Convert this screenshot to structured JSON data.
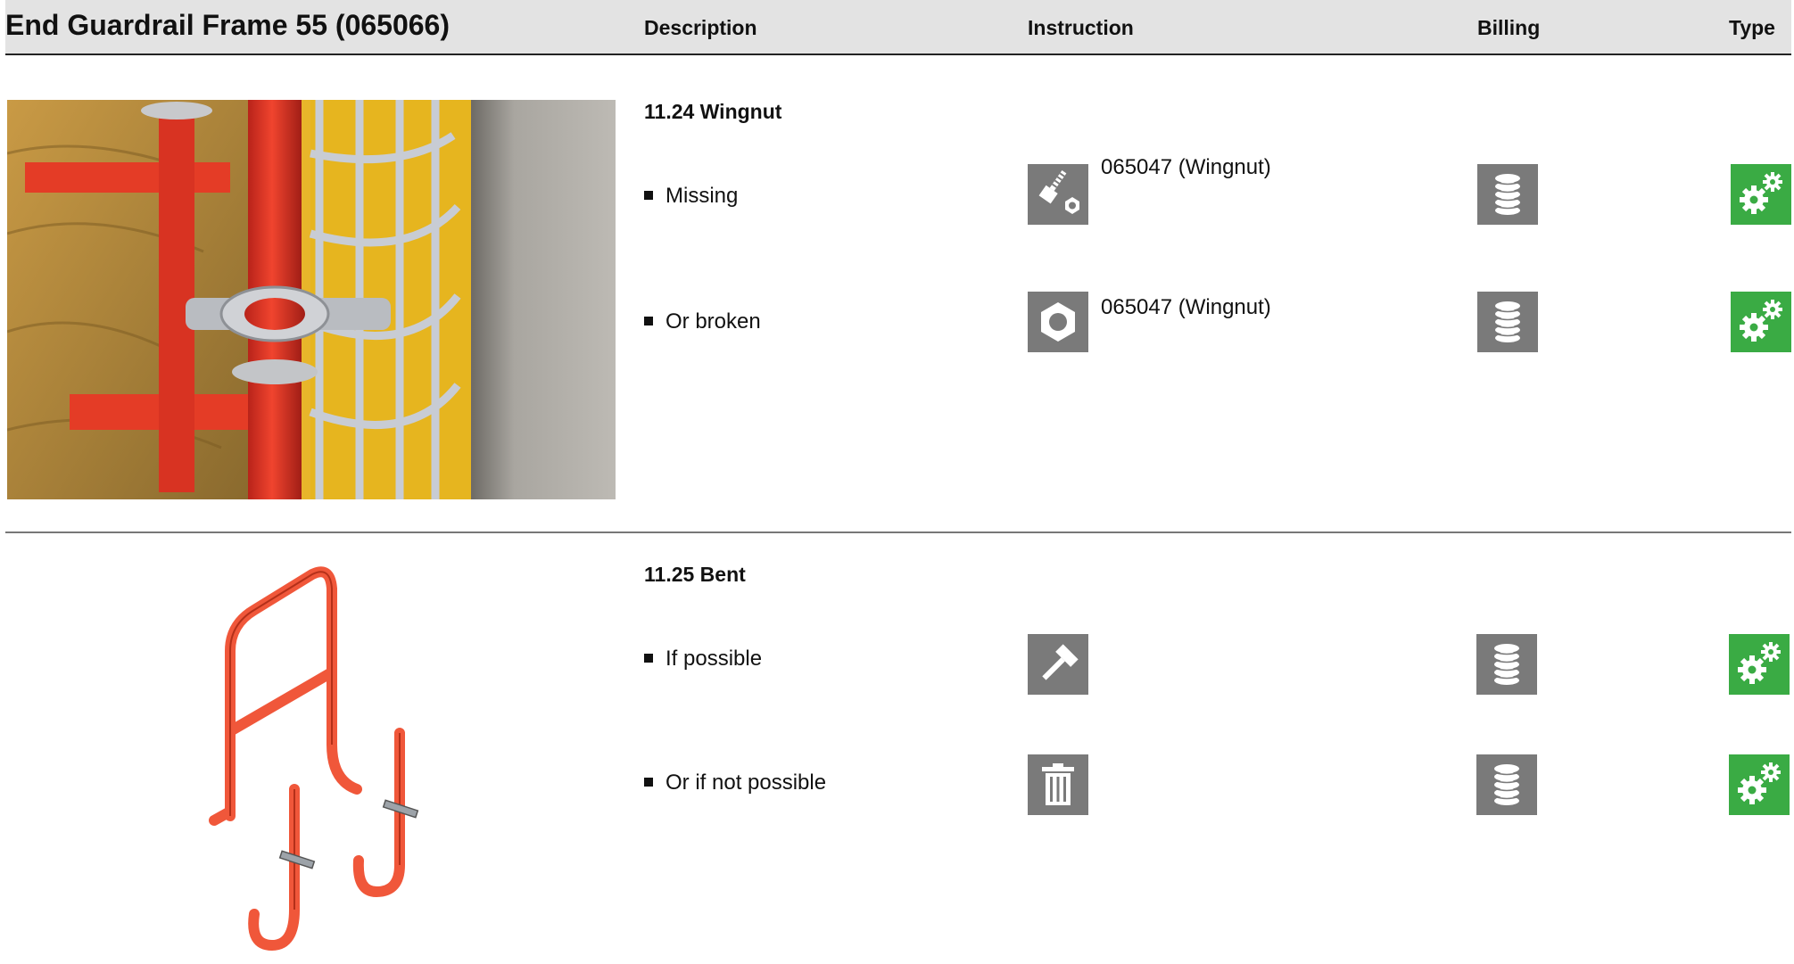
{
  "header": {
    "title": "End Guardrail Frame 55 (065066)",
    "col_description": "Description",
    "col_instruction": "Instruction",
    "col_billing": "Billing",
    "col_type": "Type"
  },
  "sections": [
    {
      "title": "11.24 Wingnut",
      "image": "photo-guardrail-wingnut",
      "items": [
        {
          "label": "Missing",
          "instruction_icon": "bolt-nut-icon",
          "instruction_text": "065047 (Wingnut)",
          "billing_icon": "coin-stack-icon",
          "type_icon": "gears-icon"
        },
        {
          "label": "Or broken",
          "instruction_icon": "nut-icon",
          "instruction_text": "065047 (Wingnut)",
          "billing_icon": "coin-stack-icon",
          "type_icon": "gears-icon"
        }
      ]
    },
    {
      "title": "11.25 Bent",
      "image": "drawing-guardrail-frame",
      "items": [
        {
          "label": "If possible",
          "instruction_icon": "hammer-icon",
          "instruction_text": "",
          "billing_icon": "coin-stack-icon",
          "type_icon": "gears-icon"
        },
        {
          "label": "Or if not possible",
          "instruction_icon": "trash-icon",
          "instruction_text": "",
          "billing_icon": "coin-stack-icon",
          "type_icon": "gears-icon"
        }
      ]
    }
  ],
  "colors": {
    "icon_gray": "#7a7a7a",
    "icon_green": "#3aab44",
    "frame_orange": "#f0573a",
    "header_bg": "#e3e3e3"
  }
}
